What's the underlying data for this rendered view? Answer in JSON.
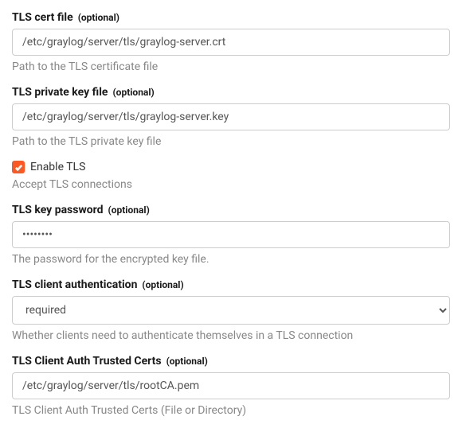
{
  "fields": {
    "tls_cert_file": {
      "label": "TLS cert file",
      "optional": "(optional)",
      "value": "/etc/graylog/server/tls/graylog-server.crt",
      "help": "Path to the TLS certificate file"
    },
    "tls_private_key_file": {
      "label": "TLS private key file",
      "optional": "(optional)",
      "value": "/etc/graylog/server/tls/graylog-server.key",
      "help": "Path to the TLS private key file"
    },
    "enable_tls": {
      "label": "Enable TLS",
      "checked": true,
      "help": "Accept TLS connections"
    },
    "tls_key_password": {
      "label": "TLS key password",
      "optional": "(optional)",
      "value": "••••••••",
      "help": "The password for the encrypted key file."
    },
    "tls_client_auth": {
      "label": "TLS client authentication",
      "optional": "(optional)",
      "value": "required",
      "help": "Whether clients need to authenticate themselves in a TLS connection"
    },
    "tls_client_auth_certs": {
      "label": "TLS Client Auth Trusted Certs",
      "optional": "(optional)",
      "value": "/etc/graylog/server/tls/rootCA.pem",
      "help": "TLS Client Auth Trusted Certs (File or Directory)"
    }
  }
}
